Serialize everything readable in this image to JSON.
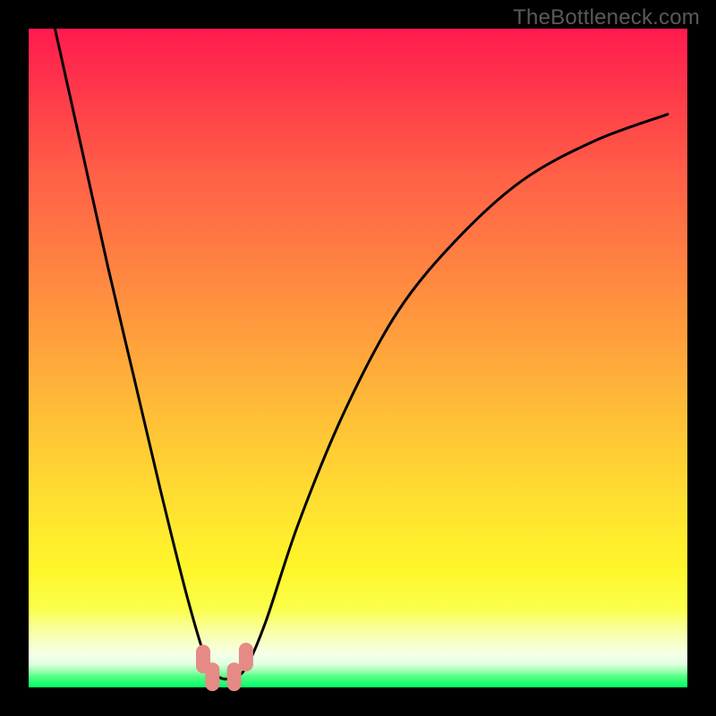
{
  "watermark": "TheBottleneck.com",
  "chart_data": {
    "type": "line",
    "title": "",
    "xlabel": "",
    "ylabel": "",
    "xlim": [
      0,
      1
    ],
    "ylim": [
      0,
      1
    ],
    "grid": false,
    "legend": false,
    "note": "Axes are unlabeled; values are normalized 0–1 estimates read from pixel positions. y=1 is top (red / high bottleneck), y=0 is bottom (green / no bottleneck). The curve forms a V with its minimum near x≈0.29.",
    "series": [
      {
        "name": "curve",
        "color": "#000000",
        "x": [
          0.04,
          0.08,
          0.12,
          0.16,
          0.2,
          0.24,
          0.27,
          0.29,
          0.31,
          0.33,
          0.36,
          0.41,
          0.48,
          0.56,
          0.65,
          0.75,
          0.86,
          0.97
        ],
        "y": [
          1.0,
          0.82,
          0.64,
          0.47,
          0.3,
          0.14,
          0.04,
          0.015,
          0.015,
          0.03,
          0.1,
          0.25,
          0.42,
          0.57,
          0.68,
          0.77,
          0.83,
          0.87
        ]
      }
    ],
    "markers": [
      {
        "shape": "rounded-rect",
        "color": "#e58a84",
        "x": 0.265,
        "y": 0.043
      },
      {
        "shape": "rounded-rect",
        "color": "#e58a84",
        "x": 0.279,
        "y": 0.016
      },
      {
        "shape": "rounded-rect",
        "color": "#e58a84",
        "x": 0.312,
        "y": 0.016
      },
      {
        "shape": "rounded-rect",
        "color": "#e58a84",
        "x": 0.33,
        "y": 0.046
      }
    ],
    "gradient_stops": [
      {
        "pos": 0.0,
        "color": "#ff1a4f"
      },
      {
        "pos": 0.5,
        "color": "#ffb238"
      },
      {
        "pos": 0.85,
        "color": "#fff62a"
      },
      {
        "pos": 1.0,
        "color": "#00ff66"
      }
    ]
  }
}
